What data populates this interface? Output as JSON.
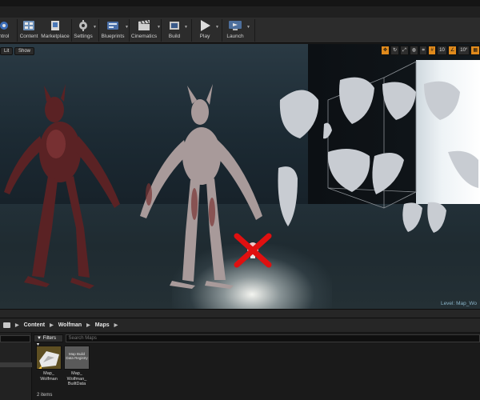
{
  "toolbar": {
    "items": [
      {
        "label": "ntrol",
        "icon": "control-icon"
      },
      {
        "label": "Content",
        "icon": "content-icon"
      },
      {
        "label": "Marketplace",
        "icon": "marketplace-icon"
      },
      {
        "label": "Settings",
        "icon": "settings-icon"
      },
      {
        "label": "Blueprints",
        "icon": "blueprints-icon"
      },
      {
        "label": "Cinematics",
        "icon": "cinematics-icon"
      },
      {
        "label": "Build",
        "icon": "build-icon"
      },
      {
        "label": "Play",
        "icon": "play-icon"
      },
      {
        "label": "Launch",
        "icon": "launch-icon"
      }
    ]
  },
  "viewport": {
    "lit_label": "Lit",
    "show_label": "Show",
    "snap_grid": "10",
    "snap_rotation": "10°",
    "level_label": "Level:  Map_Wo"
  },
  "content_browser": {
    "breadcrumb": [
      "Content",
      "Wolfman",
      "Maps"
    ],
    "filters_label": "Filters",
    "search_placeholder": "Search Maps",
    "assets": [
      {
        "name": "Map_ Wolfman",
        "thumb_label": ""
      },
      {
        "name": "Map_ Wolfman_ BuiltData",
        "thumb_label": "Map Build Data Registry"
      }
    ],
    "item_count": "2 items"
  }
}
